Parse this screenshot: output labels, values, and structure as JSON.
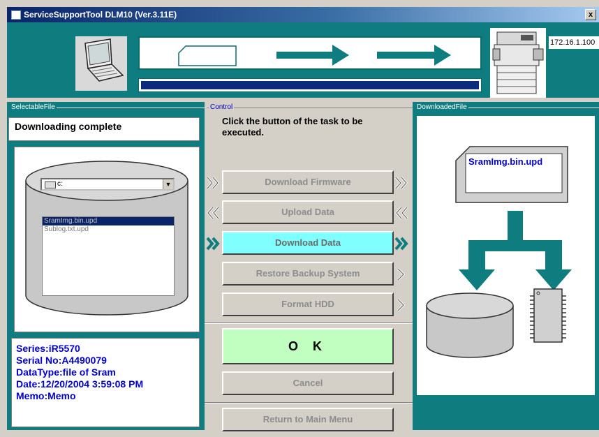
{
  "window": {
    "title": "ServiceSupportTool DLM10 (Ver.3.11E)",
    "close_label": "x"
  },
  "header": {
    "ip_address": "172.16.1.100",
    "progress": 1.0
  },
  "left": {
    "group_label": "SelectableFile",
    "status_text": "Downloading complete",
    "drive": "c:",
    "files": [
      {
        "name": "SramImg.bin.upd",
        "selected": true
      },
      {
        "name": "Sublog.txt.upd",
        "selected": false
      }
    ],
    "info": [
      "Series:iR5570",
      "Serial No:A4490079",
      "DataType:file of Sram",
      "Date:12/20/2004 3:59:08 PM",
      "Memo:Memo"
    ]
  },
  "control": {
    "group_label": "Control",
    "instruction": "Click the button of the task to be executed.",
    "buttons": {
      "download_firmware": "Download Firmware",
      "upload_data": "Upload Data",
      "download_data": "Download Data",
      "restore_backup": "Restore Backup System",
      "format_hdd": "Format HDD",
      "ok": "O K",
      "cancel": "Cancel",
      "return_main": "Return to Main Menu"
    }
  },
  "right": {
    "group_label": "DownloadedFile",
    "file_name": "SramImg.bin.upd"
  },
  "colors": {
    "teal": "#0f7c80",
    "active_button": "#80ffff",
    "ok_button": "#c0ffc0",
    "info_text": "#0000d0"
  }
}
